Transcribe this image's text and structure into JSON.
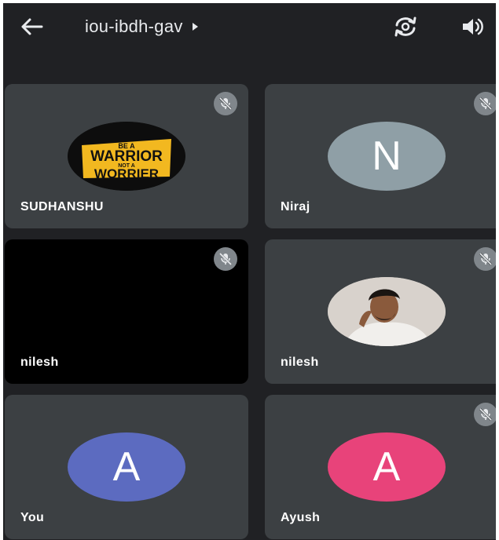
{
  "header": {
    "meeting_code": "iou-ibdh-gav"
  },
  "colors": {
    "screen_bg": "#202124",
    "tile_bg": "#3c4043",
    "avatar_niraj": "#8f9fa6",
    "avatar_you": "#5c6bc0",
    "avatar_ayush": "#e8437a",
    "warrior_yellow": "#f2b820"
  },
  "participants": [
    {
      "name": "SUDHANSHU",
      "avatar_type": "image",
      "avatar_desc": "be-a-warrior-not-a-worrier-logo",
      "muted": true
    },
    {
      "name": "Niraj",
      "avatar_type": "initial",
      "initial": "N",
      "muted": true
    },
    {
      "name": "nilesh",
      "avatar_type": "video-off-black",
      "muted": true
    },
    {
      "name": "nilesh",
      "avatar_type": "photo",
      "muted": true
    },
    {
      "name": "You",
      "avatar_type": "initial",
      "initial": "A",
      "muted": false
    },
    {
      "name": "Ayush",
      "avatar_type": "initial",
      "initial": "A",
      "muted": true
    }
  ],
  "warrior_logo": {
    "line1": "BE A",
    "line2": "WARRIOR",
    "line3": "NOT A",
    "line4": "WORRIER"
  }
}
